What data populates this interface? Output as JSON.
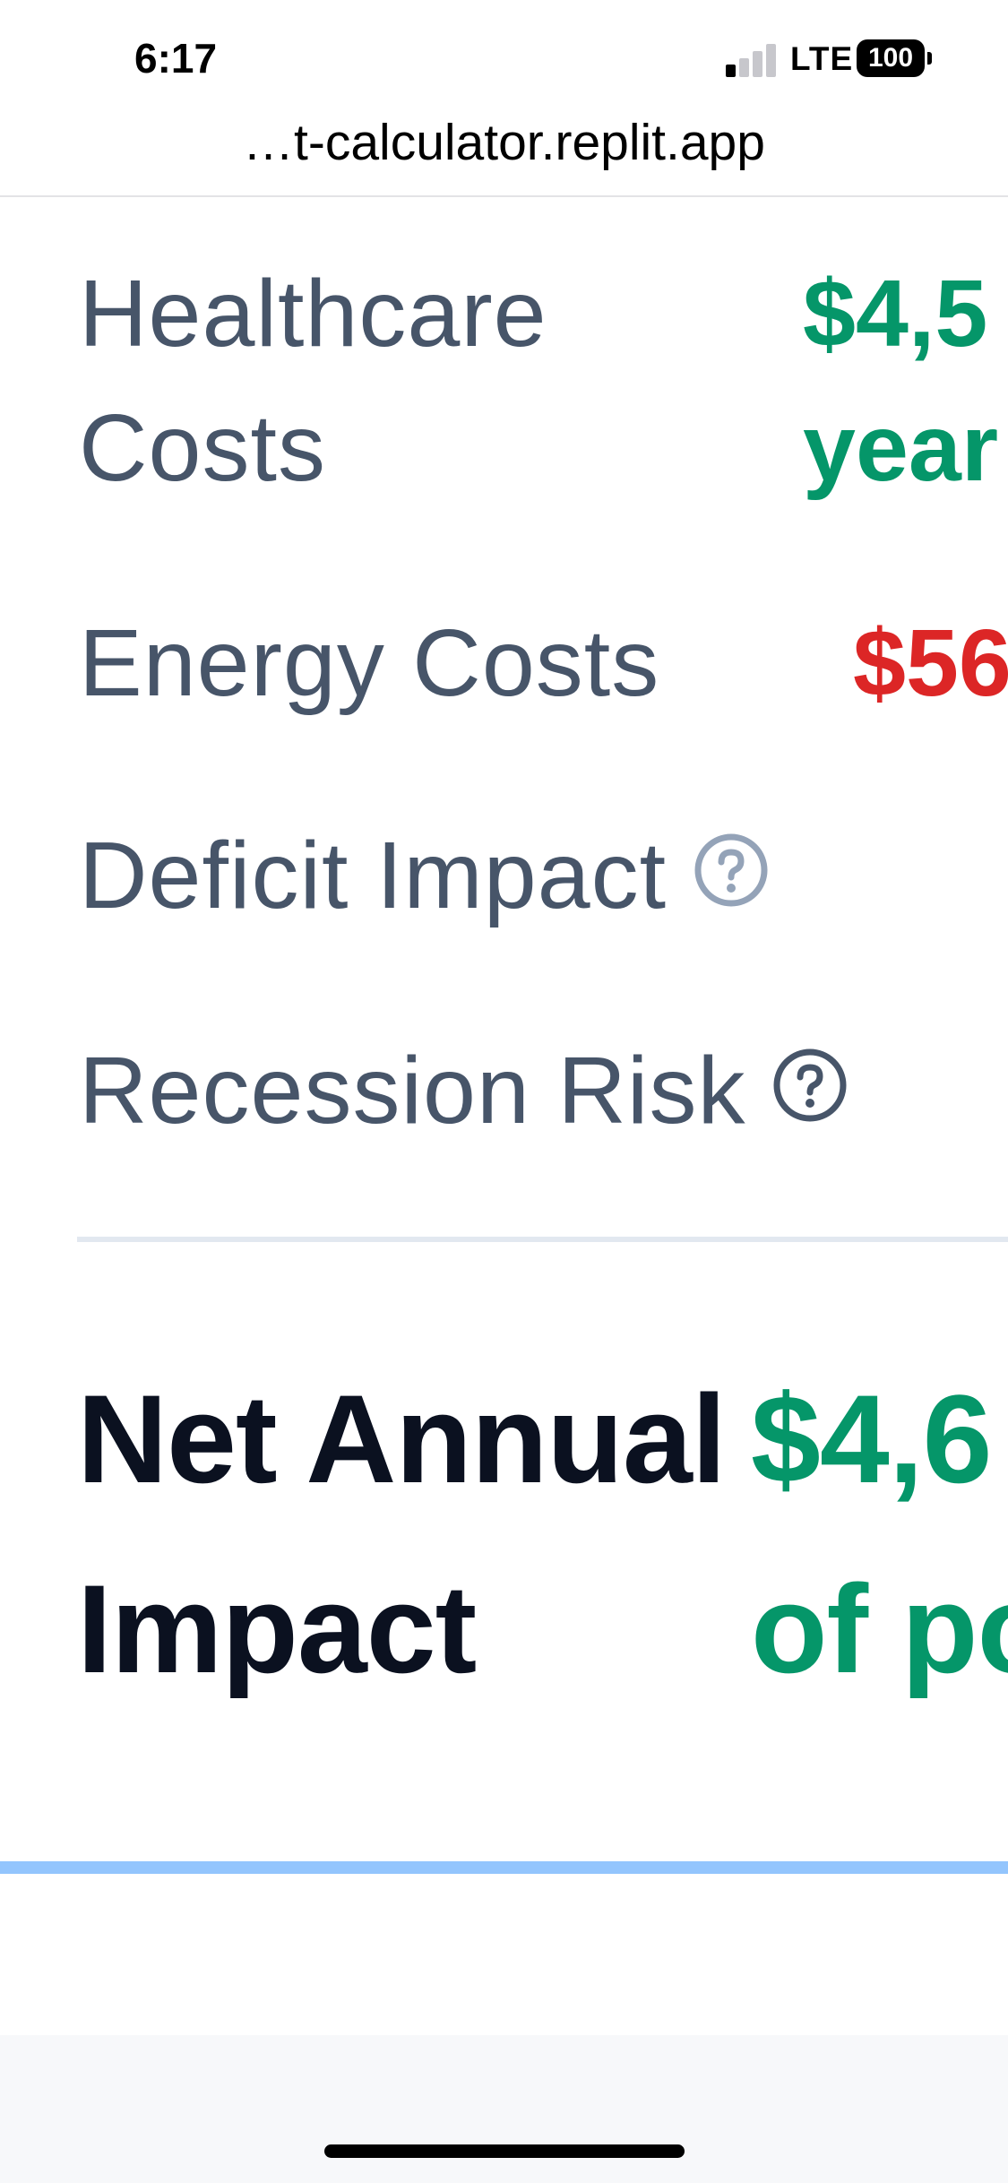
{
  "status_bar": {
    "time": "6:17",
    "network": "LTE",
    "battery": "100"
  },
  "browser": {
    "url": "…t-calculator.replit.app"
  },
  "rows": [
    {
      "label_lines": [
        "Healthcare",
        "Costs"
      ],
      "value_lines": [
        "$4,5",
        "year"
      ],
      "value_color": "#059669"
    },
    {
      "label": "Energy Costs",
      "value": "$56",
      "value_color": "#dc2626"
    },
    {
      "label": "Deficit Impact",
      "help_icon": "question-circle-icon",
      "help_icon_color": "#94a3b8"
    },
    {
      "label": "Recession Risk",
      "help_icon": "question-circle-icon",
      "help_icon_color": "#475569"
    }
  ],
  "summary": {
    "label_lines": [
      "Net Annual",
      "Impact"
    ],
    "value_lines": [
      "$4,6",
      "of po"
    ],
    "value_color": "#059669"
  },
  "colors": {
    "label_text": "#475569",
    "positive": "#059669",
    "negative": "#dc2626",
    "accent_line": "#93c5fd",
    "divider": "#e2e8f0"
  }
}
